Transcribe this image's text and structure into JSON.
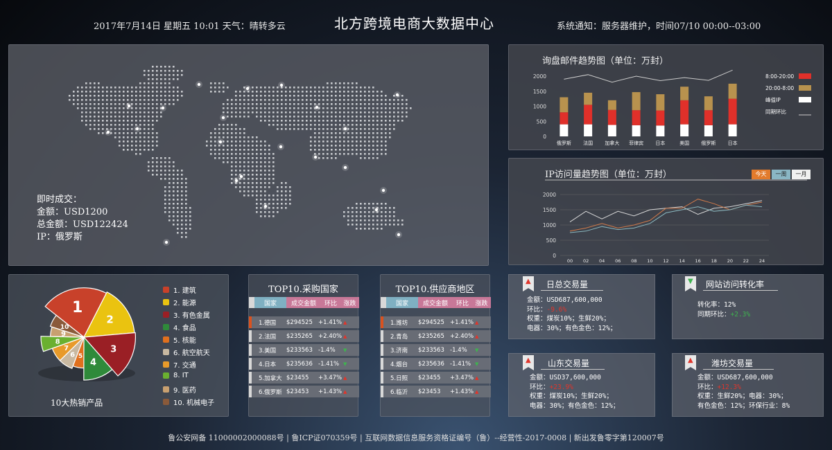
{
  "header": {
    "date": "2017年7月14日  星期五  10:01  天气：晴转多云",
    "title": "北方跨境电商大数据中心",
    "notice": "系统通知：服务器维护，时间07/10 00:00--03:00"
  },
  "map": {
    "label": "即时成交：",
    "amount": "金额：USD1200",
    "total": "总金额：USD122424",
    "ip": "IP：俄罗斯"
  },
  "mail_chart": {
    "title": "询盘邮件趋势图（单位：万封）",
    "legend": [
      "8:00-20:00",
      "20:00-8:00",
      "峰值IP",
      "同期环比"
    ],
    "colors": {
      "day": "#e0302a",
      "night": "#b8924e",
      "peak": "#ffffff",
      "yoy": "#cccccc"
    }
  },
  "ip_chart": {
    "title": "IP访问量趋势图（单位：万封）",
    "tabs": [
      "今天",
      "一周",
      "一月"
    ]
  },
  "chart_data": [
    {
      "type": "bar",
      "title": "询盘邮件趋势图（单位：万封）",
      "categories": [
        "俄罗斯",
        "法国",
        "加拿大",
        "菲律宾",
        "日本",
        "美国",
        "俄罗斯",
        "日本"
      ],
      "yticks": [
        0,
        500,
        1000,
        1500,
        2000
      ],
      "ylim": [
        0,
        2000
      ],
      "series": [
        {
          "name": "峰值IP",
          "values": [
            400,
            400,
            380,
            370,
            360,
            400,
            370,
            400
          ]
        },
        {
          "name": "8:00-20:00",
          "values": [
            400,
            650,
            500,
            500,
            500,
            800,
            500,
            850
          ]
        },
        {
          "name": "20:00-8:00",
          "values": [
            500,
            400,
            320,
            600,
            540,
            450,
            460,
            500
          ]
        },
        {
          "name": "同期环比",
          "values": [
            1900,
            2050,
            1800,
            2000,
            1850,
            1950,
            1860,
            2200
          ]
        }
      ]
    },
    {
      "type": "line",
      "title": "IP访问量趋势图（单位：万封）",
      "x": [
        "00",
        "02",
        "04",
        "06",
        "08",
        "10",
        "12",
        "14",
        "16",
        "18",
        "20",
        "22",
        "24"
      ],
      "yticks": [
        0,
        500,
        1000,
        1500,
        2000
      ],
      "ylim": [
        0,
        2000
      ],
      "series": [
        {
          "values": [
            1100,
            1450,
            1200,
            1450,
            1300,
            1500,
            1550,
            1600,
            1350,
            1550,
            1600,
            1700,
            1800
          ],
          "color": "#d8d8d8"
        },
        {
          "values": [
            800,
            900,
            1050,
            900,
            1000,
            1150,
            1550,
            1550,
            1850,
            1700,
            1500,
            1650,
            1750
          ],
          "color": "#d07a4a"
        },
        {
          "values": [
            750,
            800,
            950,
            850,
            900,
            1050,
            1400,
            1500,
            1600,
            1450,
            1500,
            1650,
            1600
          ],
          "color": "#8ab8c0"
        }
      ]
    },
    {
      "type": "pie",
      "title": "10大热销产品",
      "labels": [
        "1.建筑",
        "2.能源",
        "3.有色金属",
        "4.食品",
        "5.核能",
        "6.航空航天",
        "7.交通",
        "8.IT",
        "9.医药",
        "10.机械电子"
      ],
      "values": [
        19,
        14,
        13,
        10,
        5,
        6,
        6,
        5,
        4,
        5
      ]
    }
  ],
  "pie": {
    "caption": "10大热销产品",
    "labels": [
      "1. 建筑",
      "2. 能源",
      "3. 有色金属",
      "4. 食品",
      "5. 核能",
      "6. 航空航天",
      "7. 交通",
      "8. IT",
      "9. 医药",
      "10. 机械电子"
    ],
    "colors": [
      "#c8412a",
      "#eac310",
      "#9a1f25",
      "#2f8a3a",
      "#e0701e",
      "#c8b8a0",
      "#e89a2a",
      "#6ab030",
      "#c8a070",
      "#8a5a3a"
    ]
  },
  "buy_table": {
    "title": "TOP10.采购国家",
    "headers": [
      "国家",
      "成交金额",
      "环比",
      "涨跌"
    ],
    "rows": [
      {
        "name": "1.德国",
        "amount": "$294525",
        "ratio": "+1.41%",
        "trend": "▲"
      },
      {
        "name": "2.法国",
        "amount": "$235265",
        "ratio": "+2.40%",
        "trend": "▲"
      },
      {
        "name": "3.美国",
        "amount": "$233563",
        "ratio": "-1.4%",
        "trend": "▼"
      },
      {
        "name": "4.日本",
        "amount": "$235636",
        "ratio": "-1.41%",
        "trend": "▼"
      },
      {
        "name": "5.加拿大",
        "amount": "$23455",
        "ratio": "+3.47%",
        "trend": "▲"
      },
      {
        "name": "6.俄罗斯",
        "amount": "$23453",
        "ratio": "+1.43%",
        "trend": "▲"
      }
    ]
  },
  "sup_table": {
    "title": "TOP10.供应商地区",
    "headers": [
      "国家",
      "成交金额",
      "环比",
      "涨跌"
    ],
    "rows": [
      {
        "name": "1.潍坊",
        "amount": "$294525",
        "ratio": "+1.41%",
        "trend": "▲"
      },
      {
        "name": "2.青岛",
        "amount": "$235265",
        "ratio": "+2.40%",
        "trend": "▲"
      },
      {
        "name": "3.济南",
        "amount": "$233563",
        "ratio": "-1.4%",
        "trend": "▼"
      },
      {
        "name": "4.烟台",
        "amount": "$235636",
        "ratio": "-1.41%",
        "trend": "▼"
      },
      {
        "name": "5.日照",
        "amount": "$23455",
        "ratio": "+3.47%",
        "trend": "▲"
      },
      {
        "name": "6.临沂",
        "amount": "$23453",
        "ratio": "+1.43%",
        "trend": "▲"
      }
    ]
  },
  "stats": {
    "daily": {
      "title": "日总交易量",
      "amount": "金额：USD687,600,000",
      "ratio_label": "环比：",
      "ratio": "-9.6%",
      "weight": "权重：煤炭10%；生鲜20%；",
      "elec": "电器：30%；有色金色：12%；"
    },
    "conv": {
      "title": "网站访问转化率",
      "rate": "转化率：12%",
      "yoy_label": "同期环比：",
      "yoy": "+2.3%"
    },
    "shandong": {
      "title": "山东交易量",
      "amount": "金额：USD37,600,000",
      "ratio_label": "环比：",
      "ratio": "+23.9%",
      "weight": "权重：煤炭10%；生鲜20%；",
      "elec": "电器：30%；有色金色：12%；"
    },
    "weifang": {
      "title": "潍坊交易量",
      "amount": "金额：USD687,600,000",
      "ratio_label": "环比：",
      "ratio": "+12.3%",
      "weight": "权重：生鲜20%；电器：30%；",
      "elec": "有色金色：12%；环保行业：8%"
    }
  },
  "footer": "鲁公安网备 11000002000088号 | 鲁ICP证070359号 | 互联网数据信息服务资格证编号（鲁）--经营性-2017-0008 | 新出发鲁零字第120007号"
}
